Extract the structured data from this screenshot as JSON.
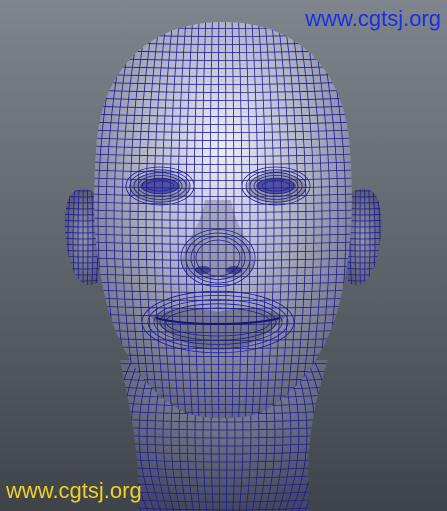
{
  "scene": {
    "subject_icon": "wireframe-head-mesh",
    "wireframe_color": "#1a1a9c",
    "background_top": "#7f858c",
    "background_bottom": "#3e444a",
    "skin_light": "#e6e6ee",
    "skin_shadow": "#5c5e70"
  },
  "watermarks": {
    "top": "www.cgtsj.org",
    "bottom": "www.cgtsj.org",
    "top_color": "#1c2de6",
    "bottom_color": "#f0d020"
  }
}
